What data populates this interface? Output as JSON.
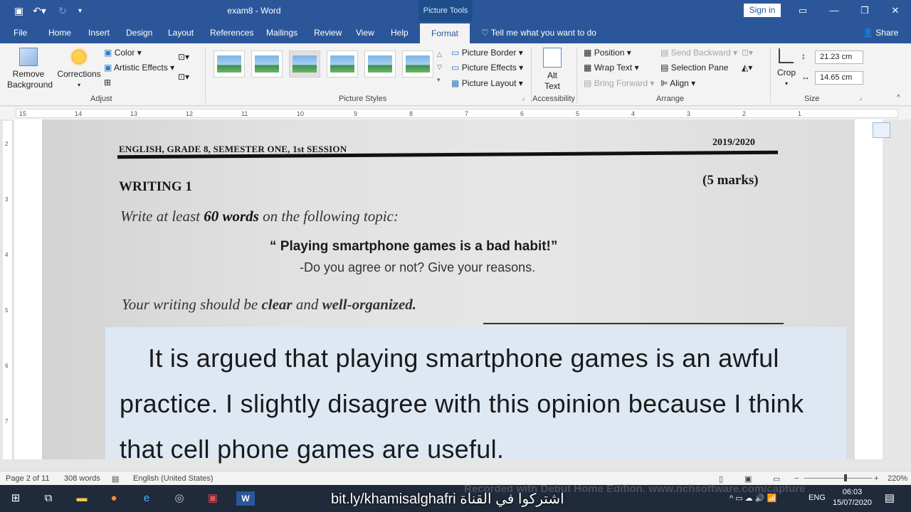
{
  "window": {
    "doc_title": "exam8 - Word",
    "context_tab_group": "Picture Tools",
    "signin_label": "Sign in"
  },
  "tabs": [
    "File",
    "Home",
    "Insert",
    "Design",
    "Layout",
    "References",
    "Mailings",
    "Review",
    "View",
    "Help"
  ],
  "active_tab": "Format",
  "tell_me": "Tell me what you want to do",
  "share_label": "Share",
  "ribbon": {
    "adjust": {
      "remove_background": "Remove Background",
      "corrections": "Corrections",
      "color": "Color",
      "artistic_effects": "Artistic Effects",
      "group_label": "Adjust"
    },
    "picture_styles": {
      "border": "Picture Border",
      "effects": "Picture Effects",
      "layout": "Picture Layout",
      "group_label": "Picture Styles"
    },
    "accessibility": {
      "alt_text": "Alt Text",
      "group_label": "Accessibility"
    },
    "arrange": {
      "position": "Position",
      "wrap_text": "Wrap Text",
      "bring_forward": "Bring Forward",
      "send_backward": "Send Backward",
      "selection_pane": "Selection Pane",
      "align": "Align",
      "group_label": "Arrange"
    },
    "size": {
      "crop": "Crop",
      "height": "21.23 cm",
      "width": "14.65 cm",
      "group_label": "Size"
    }
  },
  "ruler": {
    "numbers": [
      "15",
      "14",
      "13",
      "12",
      "11",
      "10",
      "9",
      "8",
      "7",
      "6",
      "5",
      "4",
      "3",
      "2",
      "1"
    ],
    "vertical_numbers": [
      "2",
      "3",
      "4",
      "5",
      "6",
      "7"
    ]
  },
  "document": {
    "photo": {
      "header_left": "ENGLISH, GRADE 8, SEMESTER ONE, 1st SESSION",
      "header_right": "2019/2020",
      "writing_title": "WRITING 1",
      "marks": "(5 marks)",
      "instruction_a": "Write at least ",
      "instruction_bold": "60 words",
      "instruction_b": " on the following topic:",
      "topic": "“ Playing smartphone games is a bad habit!”",
      "subtopic": "-Do you agree or not? Give your reasons.",
      "clear_a": "Your writing should be ",
      "clear_b1": "clear",
      "clear_and": " and ",
      "clear_b2": "well-organized."
    },
    "essay": "It is argued that playing smartphone games is an awful practice. I slightly disagree with this opinion because I think that cell phone games are useful."
  },
  "status_bar": {
    "page": "Page 2 of 11",
    "words": "308 words",
    "language": "English (United States)",
    "zoom": "220%"
  },
  "taskbar": {
    "banner": "bit.ly/khamisalghafri اشتركوا في القناة",
    "language": "ENG",
    "time": "06:03",
    "date": "15/07/2020",
    "watermark": "Recorded with Debut Home Edition. www.nchsoftware.com/capture"
  }
}
